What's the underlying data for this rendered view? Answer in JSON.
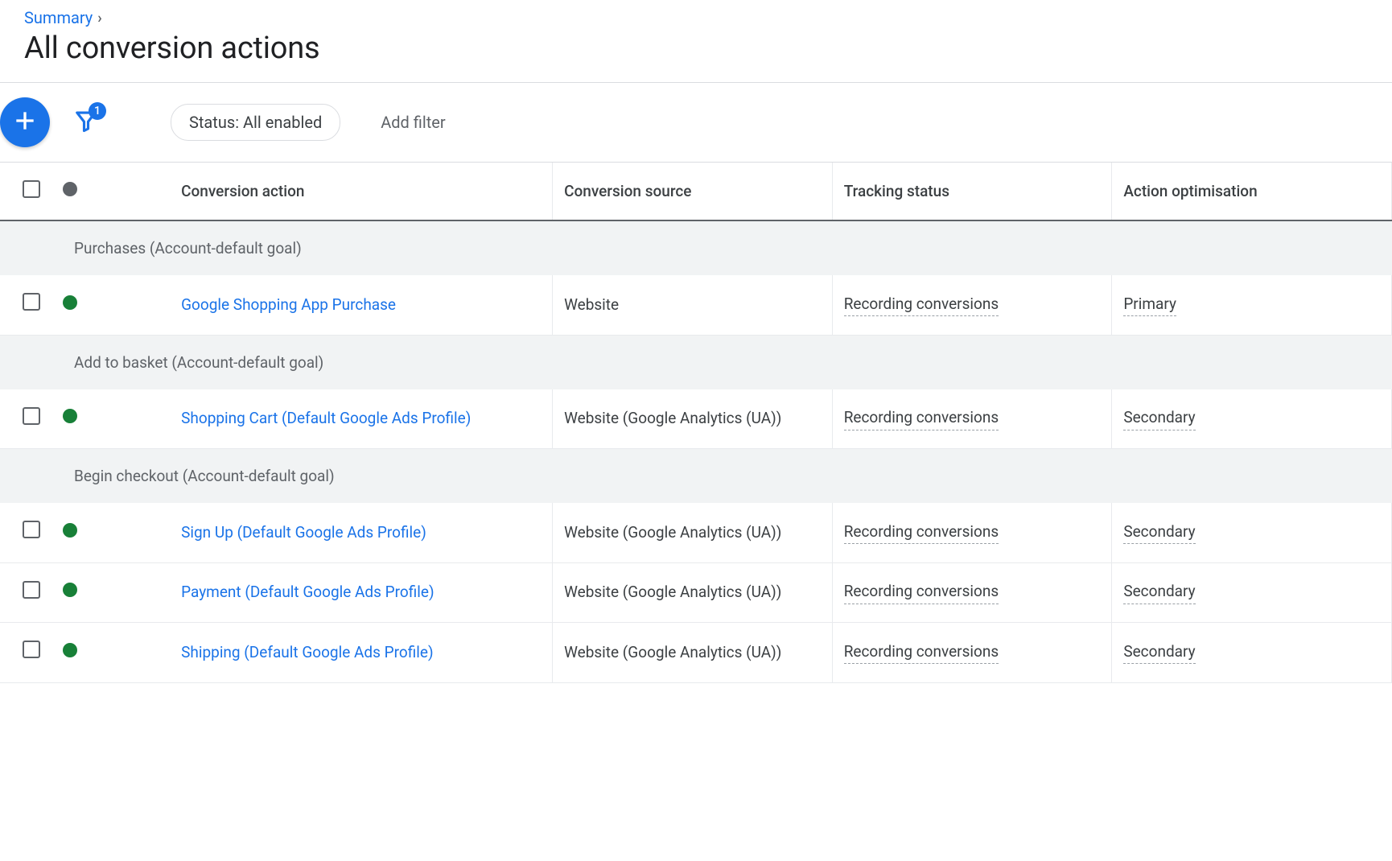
{
  "breadcrumb": {
    "summary": "Summary"
  },
  "page_title": "All conversion actions",
  "toolbar": {
    "filter_chip": "Status: All enabled",
    "add_filter": "Add filter",
    "filter_badge": "1"
  },
  "table": {
    "headers": {
      "name": "Conversion action",
      "source": "Conversion source",
      "tracking": "Tracking status",
      "opt": "Action optimisation"
    },
    "groups": [
      {
        "label": "Purchases (Account-default goal)",
        "rows": [
          {
            "name": "Google Shopping App Purchase",
            "source": "Website",
            "tracking": "Recording conversions",
            "opt": "Primary"
          }
        ]
      },
      {
        "label": "Add to basket (Account-default goal)",
        "rows": [
          {
            "name": "Shopping Cart (Default Google Ads Profile)",
            "source": "Website (Google Analytics (UA))",
            "tracking": "Recording conversions",
            "opt": "Secondary"
          }
        ]
      },
      {
        "label": "Begin checkout (Account-default goal)",
        "rows": [
          {
            "name": "Sign Up (Default Google Ads Profile)",
            "source": "Website (Google Analytics (UA))",
            "tracking": "Recording conversions",
            "opt": "Secondary"
          },
          {
            "name": "Payment (Default Google Ads Profile)",
            "source": "Website (Google Analytics (UA))",
            "tracking": "Recording conversions",
            "opt": "Secondary"
          },
          {
            "name": "Shipping (Default Google Ads Profile)",
            "source": "Website (Google Analytics (UA))",
            "tracking": "Recording conversions",
            "opt": "Secondary"
          }
        ]
      }
    ]
  }
}
